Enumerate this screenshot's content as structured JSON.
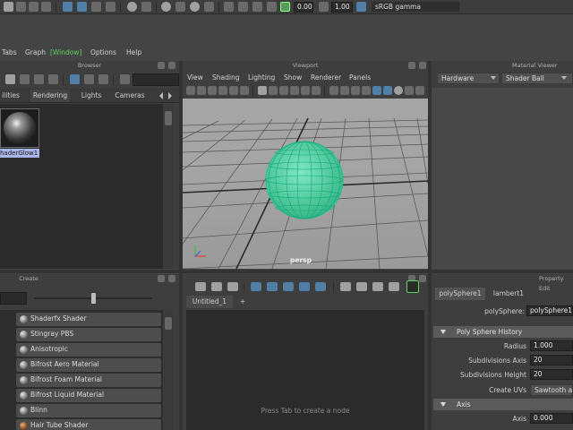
{
  "statusbar": {
    "value1": "0.00",
    "value2": "1.00",
    "colorspace": "sRGB gamma"
  },
  "menubar": {
    "items": [
      "Tabs",
      "Graph",
      "[Window]",
      "Options",
      "Help"
    ]
  },
  "browser": {
    "title": "Browser",
    "tabs": [
      "ilities",
      "Rendering",
      "Lights",
      "Cameras"
    ],
    "swatch_label": "haderGlow1"
  },
  "viewport": {
    "title": "Viewport",
    "menus": [
      "View",
      "Shading",
      "Lighting",
      "Show",
      "Renderer",
      "Panels"
    ],
    "camera_label": "persp"
  },
  "material_viewer": {
    "title": "Material Viewer",
    "renderer": "Hardware",
    "shape": "Shader Ball"
  },
  "create": {
    "title": "Create",
    "items": [
      "Shaderfx Shader",
      "Stingray PBS",
      "Anisotropic",
      "Bifrost Aero Material",
      "Bifrost Foam Material",
      "Bifrost Liquid Material",
      "Blinn",
      "Hair Tube Shader"
    ]
  },
  "node_editor": {
    "tab": "Untitled_1",
    "add_tab": "+",
    "hint": "Press Tab to create a node"
  },
  "property_editor": {
    "title": "Property Edit",
    "tabs": [
      "polySphere1",
      "lambert1"
    ],
    "node_label": "polySphere:",
    "node_value": "polySphere1",
    "sections": {
      "history": "Poly Sphere History",
      "axis": "Axis"
    },
    "fields": [
      {
        "label": "Radius",
        "value": "1.000"
      },
      {
        "label": "Subdivisions Axis",
        "value": "20"
      },
      {
        "label": "Subdivisions Height",
        "value": "20"
      },
      {
        "label": "Create UVs",
        "value": "Sawtooth at"
      }
    ],
    "axis_field": {
      "label": "Axis",
      "value": "0.000"
    }
  },
  "colors": {
    "background": "#444444",
    "panel_dark": "#2b2b2b",
    "menu_highlight": "#5bd35b",
    "wire_green": "#2fd6a0",
    "swatch_highlight": "#a9b6e8"
  }
}
